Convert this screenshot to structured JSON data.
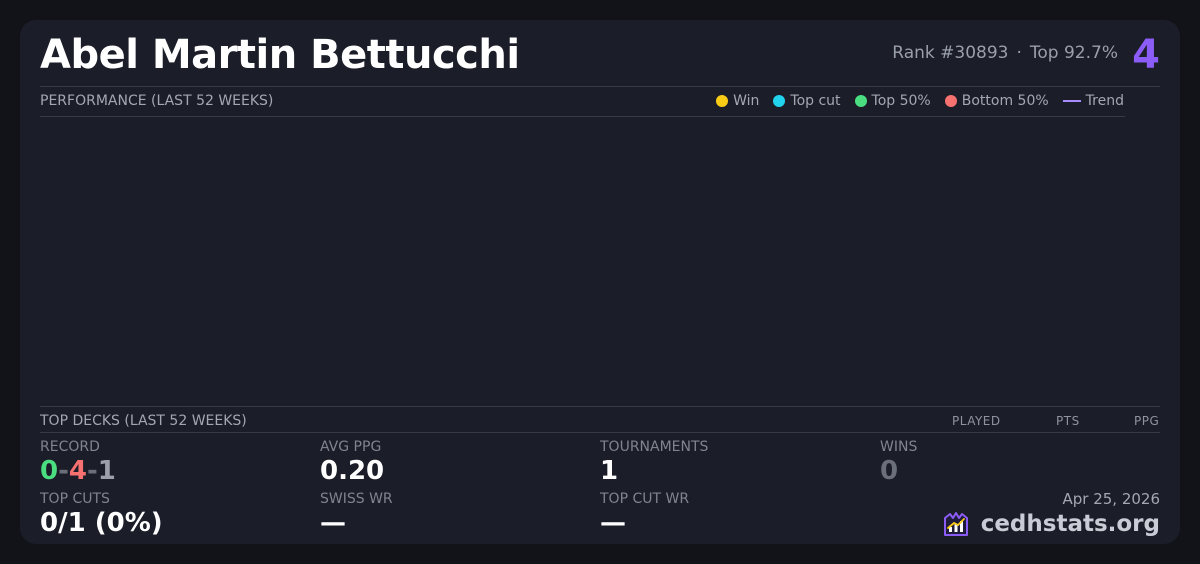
{
  "player": {
    "name": "Abel Martin Bettucchi",
    "rank_text": "Rank #30893",
    "separator": "·",
    "top_percent": "Top 92.7%",
    "rank_number": "4"
  },
  "performance": {
    "label": "PERFORMANCE (LAST 52 WEEKS)",
    "legend": [
      {
        "label": "Win",
        "color": "#facc15",
        "kind": "dot"
      },
      {
        "label": "Top cut",
        "color": "#22d3ee",
        "kind": "dot"
      },
      {
        "label": "Top 50%",
        "color": "#4ade80",
        "kind": "dot"
      },
      {
        "label": "Bottom 50%",
        "color": "#f87171",
        "kind": "dot"
      },
      {
        "label": "Trend",
        "color": "#a78bfa",
        "kind": "line"
      }
    ]
  },
  "top_decks": {
    "label": "TOP DECKS (LAST 52 WEEKS)",
    "columns": [
      "PLAYED",
      "PTS",
      "PPG"
    ]
  },
  "stats": {
    "record": {
      "label": "RECORD",
      "wins": "0",
      "losses": "4",
      "draws": "1",
      "sep": "-"
    },
    "avg_ppg": {
      "label": "AVG PPG",
      "value": "0.20"
    },
    "tournaments": {
      "label": "TOURNAMENTS",
      "value": "1"
    },
    "wins": {
      "label": "WINS",
      "value": "0"
    },
    "top_cuts": {
      "label": "TOP CUTS",
      "value": "0/1 (0%)"
    },
    "swiss_wr": {
      "label": "SWISS WR",
      "value": "—"
    },
    "top_cut_wr": {
      "label": "TOP CUT WR",
      "value": "—"
    }
  },
  "footer": {
    "date": "Apr 25, 2026",
    "brand": "cedhstats.org"
  },
  "colors": {
    "accent": "#8b5cf6",
    "win": "#4ade80",
    "loss": "#f87171"
  }
}
